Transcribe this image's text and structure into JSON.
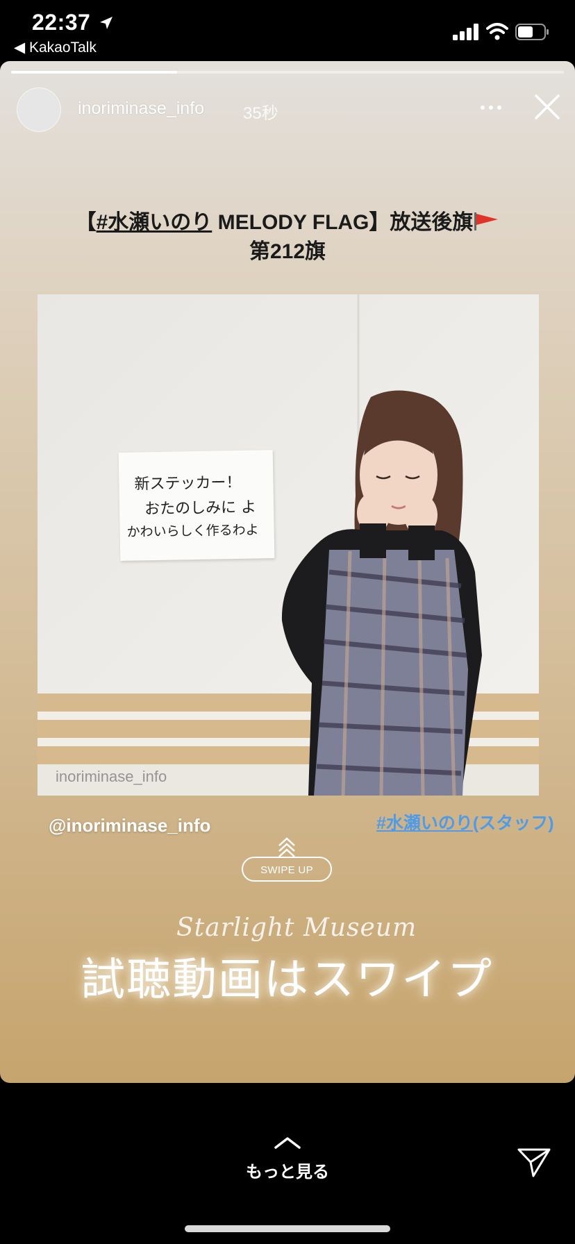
{
  "status_bar": {
    "time": "22:37",
    "back_app": "◀ KakaoTalk",
    "icons": [
      "location-arrow-icon",
      "signal-icon",
      "wifi-icon",
      "battery-icon"
    ]
  },
  "story": {
    "progress": 0.3,
    "username": "inoriminase_info",
    "time_ago": "35秒",
    "post": {
      "title_open": "【",
      "title_hashtag": "#水瀬いのり",
      "title_rest": " MELODY FLAG】放送後旗",
      "title_line2": "第212旗",
      "photo_watermark": "inoriminase_info",
      "note_lines": [
        "新ステッカー！",
        "おたのしみに よ",
        "かわいらしく作るわよ"
      ]
    },
    "mention": "@inoriminase_info",
    "hashtag": "#水瀬いのり",
    "hashtag_suffix": "(スタッフ)",
    "swipe_up_label": "SWIPE UP",
    "script_title": "Starlight Museum",
    "caption": "試聴動画はスワイプ"
  },
  "footer": {
    "more_label": "もっと見る"
  },
  "colors": {
    "hashtag_blue": "#4f9be8",
    "story_top": "#e3e0dc",
    "story_bottom": "#c6a46d"
  }
}
